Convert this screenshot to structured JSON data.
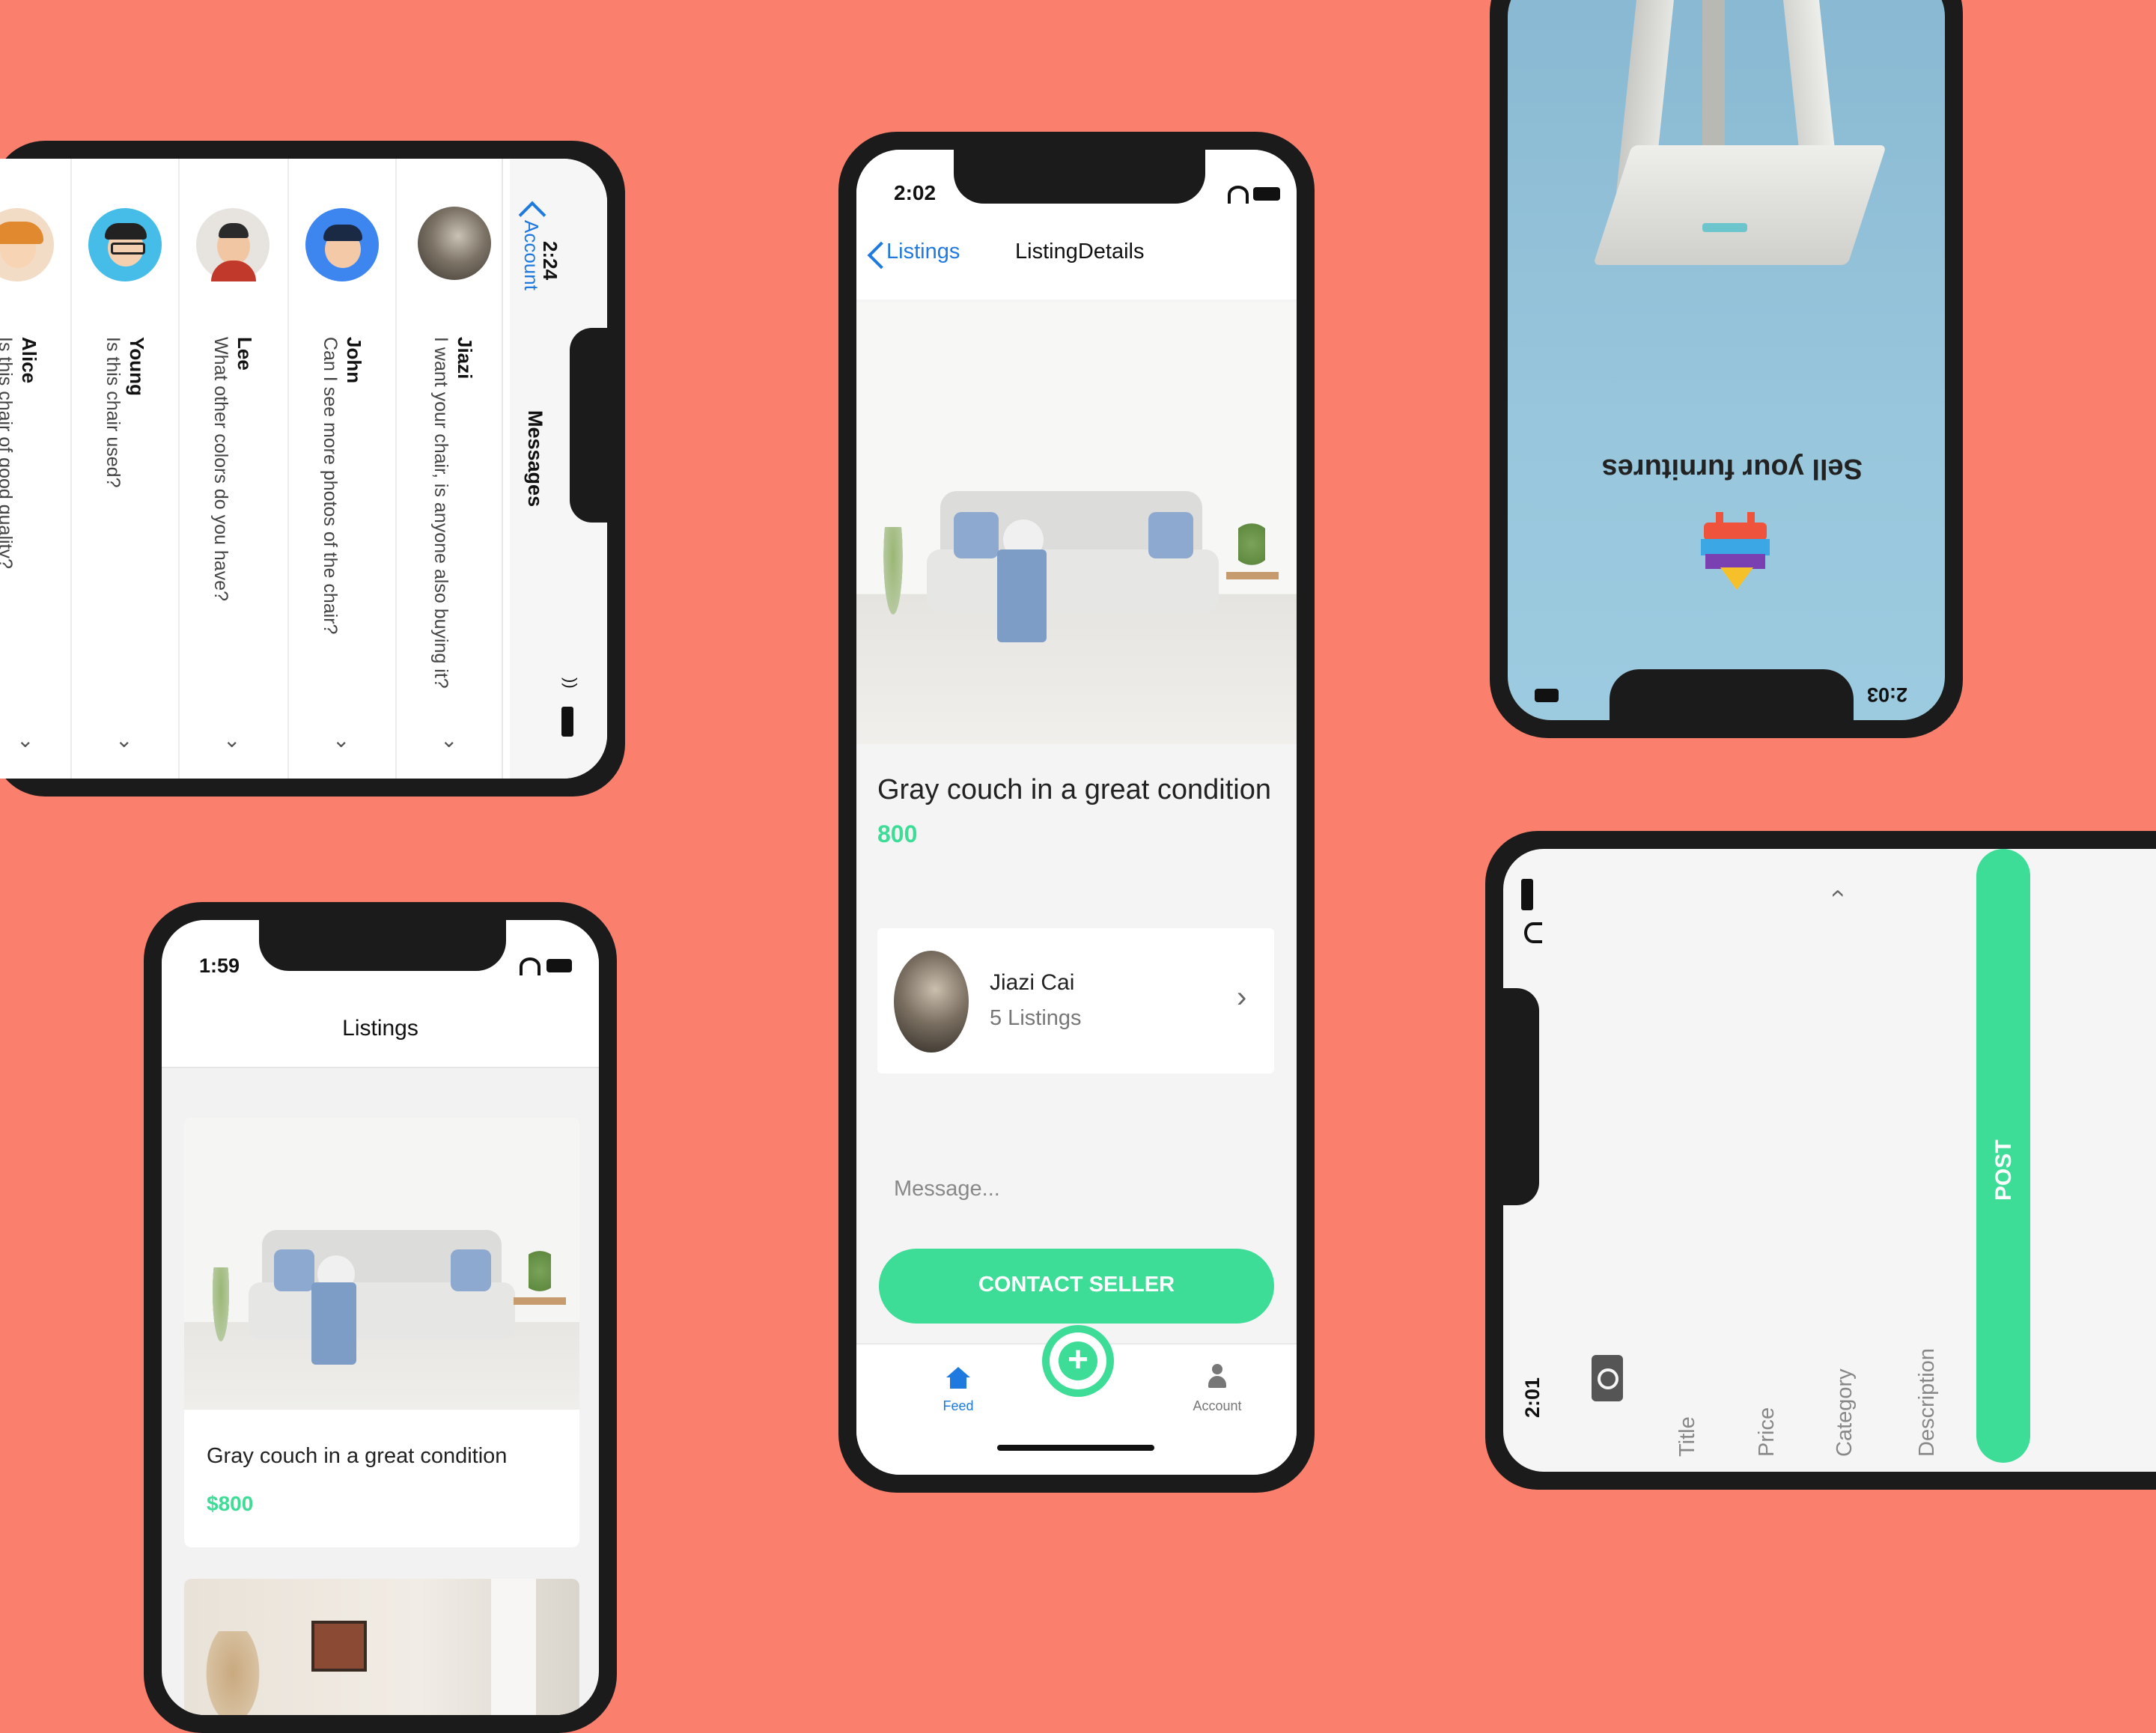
{
  "colors": {
    "background": "#fb7f6d",
    "accent": "#3ddc97",
    "link": "#1f7ae0",
    "frame": "#1b1b1b"
  },
  "messages_screen": {
    "time": "2:24",
    "back_label": "Account",
    "title": "Messages",
    "conversations": [
      {
        "name": "Jiazi",
        "preview": "I want your chair, is anyone also buying it?"
      },
      {
        "name": "John",
        "preview": "Can I see more photos of the chair?"
      },
      {
        "name": "Lee",
        "preview": "What other colors do you have?"
      },
      {
        "name": "Young",
        "preview": "Is this chair used?"
      },
      {
        "name": "Alice",
        "preview": "Is this chair of good quality?"
      }
    ]
  },
  "listings_screen": {
    "time": "1:59",
    "title": "Listings",
    "items": [
      {
        "title": "Gray couch in a great condition",
        "price": "$800"
      }
    ]
  },
  "details_screen": {
    "time": "2:02",
    "back_label": "Listings",
    "title": "ListingDetails",
    "listing_title": "Gray couch in a great condition",
    "price": "800",
    "seller_name": "Jiazi Cai",
    "seller_listings": "5 Listings",
    "message_placeholder": "Message...",
    "contact_button": "CONTACT SELLER",
    "tabs": {
      "feed": "Feed",
      "account": "Account"
    }
  },
  "splash_screen": {
    "time": "2:03",
    "tagline": "Sell your furnitures"
  },
  "post_screen": {
    "time": "2:01",
    "fields": [
      "Title",
      "Price",
      "Category",
      "Description"
    ],
    "post_button": "POST"
  }
}
